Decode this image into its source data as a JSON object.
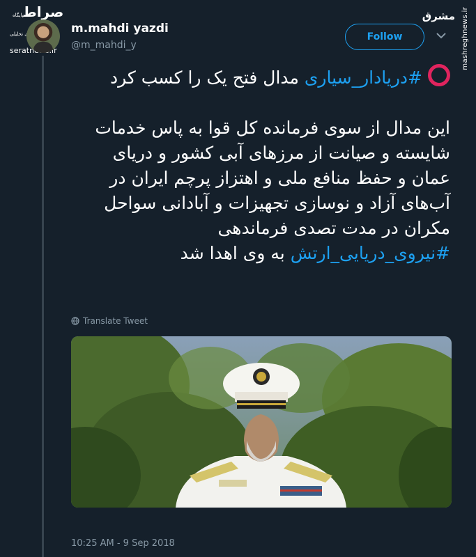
{
  "watermarks": {
    "left_logo": "صراط",
    "left_tagline": "پایگاه خبری تحلیلی",
    "left_site": "seratnews.ir",
    "right_logo": "مشرق",
    "right_site": "mashreghnews.ir"
  },
  "author": {
    "display_name": "m.mahdi yazdi",
    "handle": "@m_mahdi_y"
  },
  "follow_button": {
    "label": "Follow"
  },
  "tweet": {
    "line1_hashtag": "#دریادار_سیاری",
    "line1_text": " مدال فتح یک را کسب کرد",
    "body_part1": "این مدال از سوی فرمانده کل قوا به پاس خدمات شایسته و صیانت از مرزهای آبی کشور و دریای عمان و حفظ منافع ملی و اهتزاز پرچم ایران در آب‌های آزاد و نوسازی تجهیزات و آبادانی سواحل مکران در مدت تصدی فرماندهی ",
    "body_hashtag": "#نیروی_دریایی_ارتش",
    "body_part2": " به وی اهدا شد"
  },
  "translate_label": "Translate Tweet",
  "timestamp": "10:25 AM - 9 Sep 2018",
  "colors": {
    "background": "#15202b",
    "accent": "#1da1f2",
    "muted": "#8899a6",
    "red_circle": "#e0245e"
  },
  "icons": {
    "red_circle": "red-circle-icon",
    "chevron": "chevron-down-icon",
    "globe": "globe-icon"
  }
}
